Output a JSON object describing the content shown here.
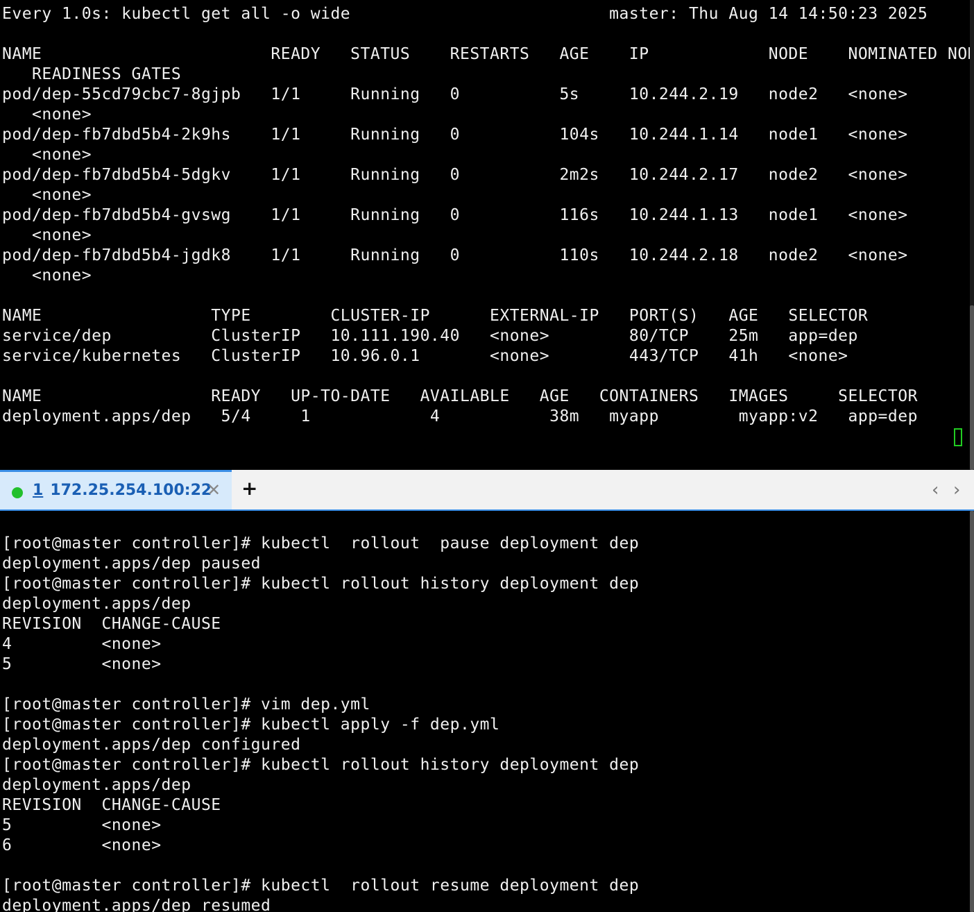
{
  "top_terminal": {
    "lines": [
      "Every 1.0s: kubectl get all -o wide                          master: Thu Aug 14 14:50:23 2025",
      "",
      "NAME                       READY   STATUS    RESTARTS   AGE    IP            NODE    NOMINATED NODE",
      "   READINESS GATES",
      "pod/dep-55cd79cbc7-8gjpb   1/1     Running   0          5s     10.244.2.19   node2   <none>",
      "   <none>",
      "pod/dep-fb7dbd5b4-2k9hs    1/1     Running   0          104s   10.244.1.14   node1   <none>",
      "   <none>",
      "pod/dep-fb7dbd5b4-5dgkv    1/1     Running   0          2m2s   10.244.2.17   node2   <none>",
      "   <none>",
      "pod/dep-fb7dbd5b4-gvswg    1/1     Running   0          116s   10.244.1.13   node1   <none>",
      "   <none>",
      "pod/dep-fb7dbd5b4-jgdk8    1/1     Running   0          110s   10.244.2.18   node2   <none>",
      "   <none>",
      "",
      "NAME                 TYPE        CLUSTER-IP      EXTERNAL-IP   PORT(S)   AGE   SELECTOR",
      "service/dep          ClusterIP   10.111.190.40   <none>        80/TCP    25m   app=dep",
      "service/kubernetes   ClusterIP   10.96.0.1       <none>        443/TCP   41h   <none>",
      "",
      "NAME                 READY   UP-TO-DATE   AVAILABLE   AGE   CONTAINERS   IMAGES     SELECTOR",
      "deployment.apps/dep   5/4     1            4           38m   myapp        myapp:v2   app=dep"
    ]
  },
  "tabbar": {
    "tab_number": "1",
    "tab_title": "172.25.254.100:22",
    "close_glyph": "✕",
    "new_tab_glyph": "+",
    "nav_left_glyph": "‹",
    "nav_right_glyph": "›",
    "status_color": "#22c02c",
    "accent_color": "#3a8ee6"
  },
  "bottom_terminal": {
    "lines": [
      "[root@master controller]# kubectl  rollout  pause deployment dep",
      "deployment.apps/dep paused",
      "[root@master controller]# kubectl rollout history deployment dep",
      "deployment.apps/dep",
      "REVISION  CHANGE-CAUSE",
      "4         <none>",
      "5         <none>",
      "",
      "[root@master controller]# vim dep.yml",
      "[root@master controller]# kubectl apply -f dep.yml",
      "deployment.apps/dep configured",
      "[root@master controller]# kubectl rollout history deployment dep",
      "deployment.apps/dep",
      "REVISION  CHANGE-CAUSE",
      "5         <none>",
      "6         <none>",
      "",
      "[root@master controller]# kubectl  rollout resume deployment dep",
      "deployment.apps/dep resumed"
    ]
  },
  "cursor_color": "#22cc22"
}
